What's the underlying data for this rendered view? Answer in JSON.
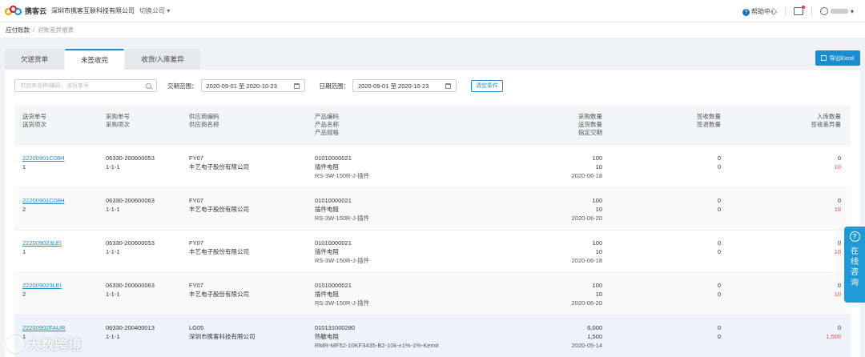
{
  "topbar": {
    "logo_text": "携客云",
    "company": "深圳市携客互联科技有限公司",
    "switch_label": "切换公司 ▾",
    "help_label": "帮助中心",
    "user_suffix": "▾"
  },
  "breadcrumb": {
    "parent": "应付账款",
    "separator": "/",
    "current": "对账差异报表"
  },
  "tabs": [
    {
      "label": "欠送货单",
      "active": false
    },
    {
      "label": "未签收完",
      "active": true
    },
    {
      "label": "收货/入库差异",
      "active": false
    }
  ],
  "export_label": "导出Excel",
  "filter": {
    "search_placeholder": "供应商名称/编码、送货单号",
    "delivery_label": "交期范围：",
    "delivery_range": "2020-09-01 至 2020-10-23",
    "date_label": "日期范围：",
    "date_range": "2020-09-01 至 2020-10-23",
    "clear_label": "清空条件"
  },
  "headers": {
    "c1": [
      "送货单号",
      "送货项次"
    ],
    "c2": [
      "采购单号",
      "采购项次"
    ],
    "c3": [
      "供应商编码",
      "供应商名称"
    ],
    "c4": [
      "产品编码",
      "产品名称",
      "产品规格"
    ],
    "c5": [
      "采购数量",
      "送货数量",
      "指定交期"
    ],
    "c6": [
      "签收数量",
      "签退数量"
    ],
    "c7": [
      "入库数量",
      "签收差异量"
    ]
  },
  "rows": [
    {
      "delivery_no": "22200901C08H",
      "delivery_item": "1",
      "po_no": "06330-200600053",
      "po_item": "1-1-1",
      "supplier_code": "FY07",
      "supplier_name": "丰艺电子股份有限公司",
      "product_code": "01010000021",
      "product_name": "插件电阻",
      "product_spec": "RS-3W-150R-J-插件",
      "purchase_qty": "100",
      "delivery_qty": "10",
      "due_date": "2020-06-18",
      "sign_qty": "0",
      "return_qty": "0",
      "stock_qty": "0",
      "diff_qty": "10"
    },
    {
      "delivery_no": "22200901C08H",
      "delivery_item": "2",
      "po_no": "06330-200600063",
      "po_item": "1-1-1",
      "supplier_code": "FY07",
      "supplier_name": "丰艺电子股份有限公司",
      "product_code": "01010000021",
      "product_name": "插件电阻",
      "product_spec": "RS-3W-150R-J-插件",
      "purchase_qty": "100",
      "delivery_qty": "10",
      "due_date": "2020-06-20",
      "sign_qty": "0",
      "return_qty": "0",
      "stock_qty": "0",
      "diff_qty": "10"
    },
    {
      "delivery_no": "222009023LEI",
      "delivery_item": "1",
      "po_no": "06330-200600053",
      "po_item": "1-1-1",
      "supplier_code": "FY07",
      "supplier_name": "丰艺电子股份有限公司",
      "product_code": "01010000021",
      "product_name": "插件电阻",
      "product_spec": "RS-3W-150R-J-插件",
      "purchase_qty": "100",
      "delivery_qty": "10",
      "due_date": "2020-06-18",
      "sign_qty": "0",
      "return_qty": "0",
      "stock_qty": "0",
      "diff_qty": "10"
    },
    {
      "delivery_no": "222009023LEI",
      "delivery_item": "2",
      "po_no": "06330-200600063",
      "po_item": "1-1-1",
      "supplier_code": "FY07",
      "supplier_name": "丰艺电子股份有限公司",
      "product_code": "01010000021",
      "product_name": "插件电阻",
      "product_spec": "RS-3W-150R-J-插件",
      "purchase_qty": "100",
      "delivery_qty": "10",
      "due_date": "2020-06-20",
      "sign_qty": "0",
      "return_qty": "0",
      "stock_qty": "0",
      "diff_qty": "10"
    },
    {
      "delivery_no": "22200902FAUR",
      "delivery_item": "1",
      "po_no": "06330-200400013",
      "po_item": "1-1-1",
      "supplier_code": "LG05",
      "supplier_name": "深圳市携客科技有限公司",
      "product_code": "010131000280",
      "product_name": "热敏电阻",
      "product_spec": "RMR-MF52-10KF3435-B2-10k-±1%-1%-Kemit",
      "purchase_qty": "6,000",
      "delivery_qty": "1,500",
      "due_date": "2020-05-14",
      "sign_qty": "0",
      "return_qty": "0",
      "stock_qty": "0",
      "diff_qty": "1,500"
    }
  ],
  "consult": {
    "icon": "?",
    "label": "在线咨询"
  },
  "watermark": "大数跨境",
  "colors": {
    "accent": "#1a8dd0",
    "diff": "#e34a4a"
  }
}
